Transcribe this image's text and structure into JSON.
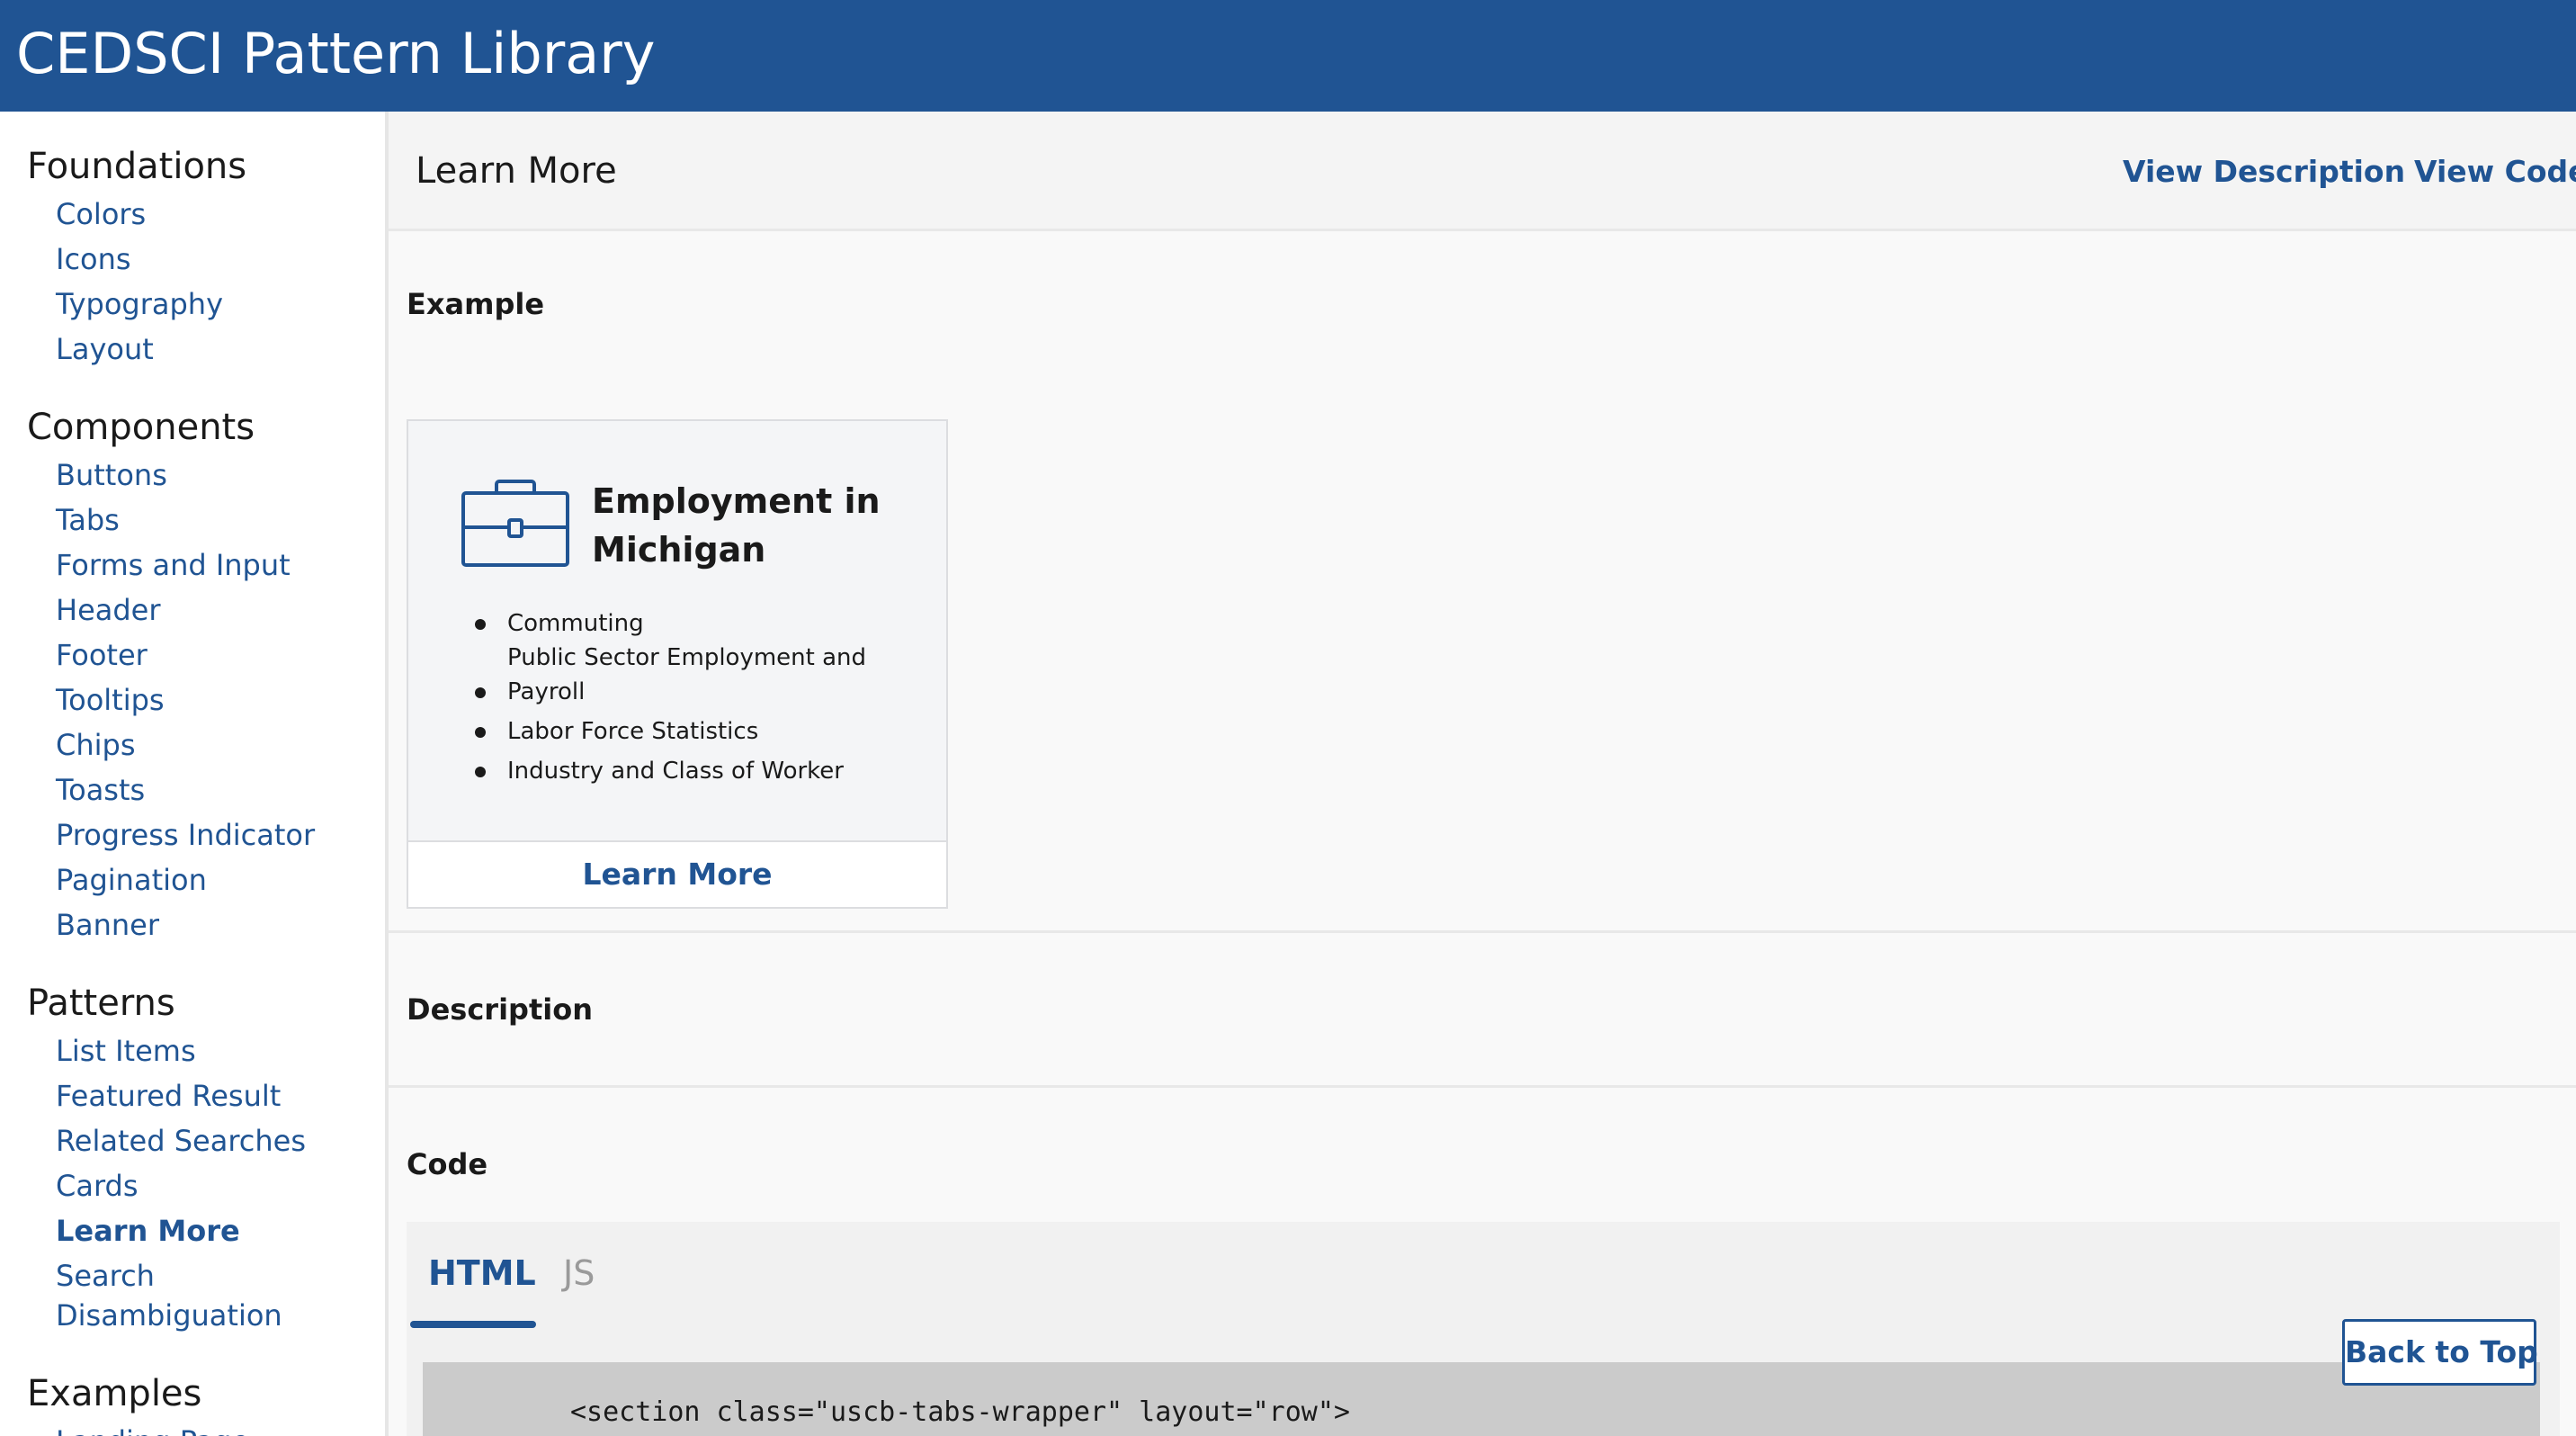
{
  "app": {
    "title": "CEDSCI Pattern Library",
    "brand_color": "#205493"
  },
  "sidebar": {
    "sections": [
      {
        "heading": "Foundations",
        "items": [
          "Colors",
          "Icons",
          "Typography",
          "Layout"
        ]
      },
      {
        "heading": "Components",
        "items": [
          "Buttons",
          "Tabs",
          "Forms and Input",
          "Header",
          "Footer",
          "Tooltips",
          "Chips",
          "Toasts",
          "Progress Indicator",
          "Pagination",
          "Banner"
        ]
      },
      {
        "heading": "Patterns",
        "items": [
          "List Items",
          "Featured Result",
          "Related Searches",
          "Cards",
          "Learn More",
          "Search",
          "Disambiguation"
        ],
        "active": "Learn More"
      },
      {
        "heading": "Examples",
        "items": [
          "Landing Page"
        ]
      }
    ]
  },
  "page": {
    "title": "Learn More",
    "links": {
      "view_description": "View Description",
      "view_code": "View Code"
    },
    "sections": {
      "example": "Example",
      "description": "Description",
      "code": "Code"
    }
  },
  "card": {
    "icon": "briefcase-icon",
    "title": "Employment in Michigan",
    "items": [
      "Commuting",
      "Public Sector Employment and",
      "Payroll",
      "Labor Force Statistics",
      "Industry and Class of Worker"
    ],
    "footer_link": "Learn More"
  },
  "code": {
    "tabs": [
      "HTML",
      "JS"
    ],
    "active_tab": "HTML",
    "first_line": "<section class=\"uscb-tabs-wrapper\" layout=\"row\">"
  },
  "back_to_top": "Back to Top"
}
